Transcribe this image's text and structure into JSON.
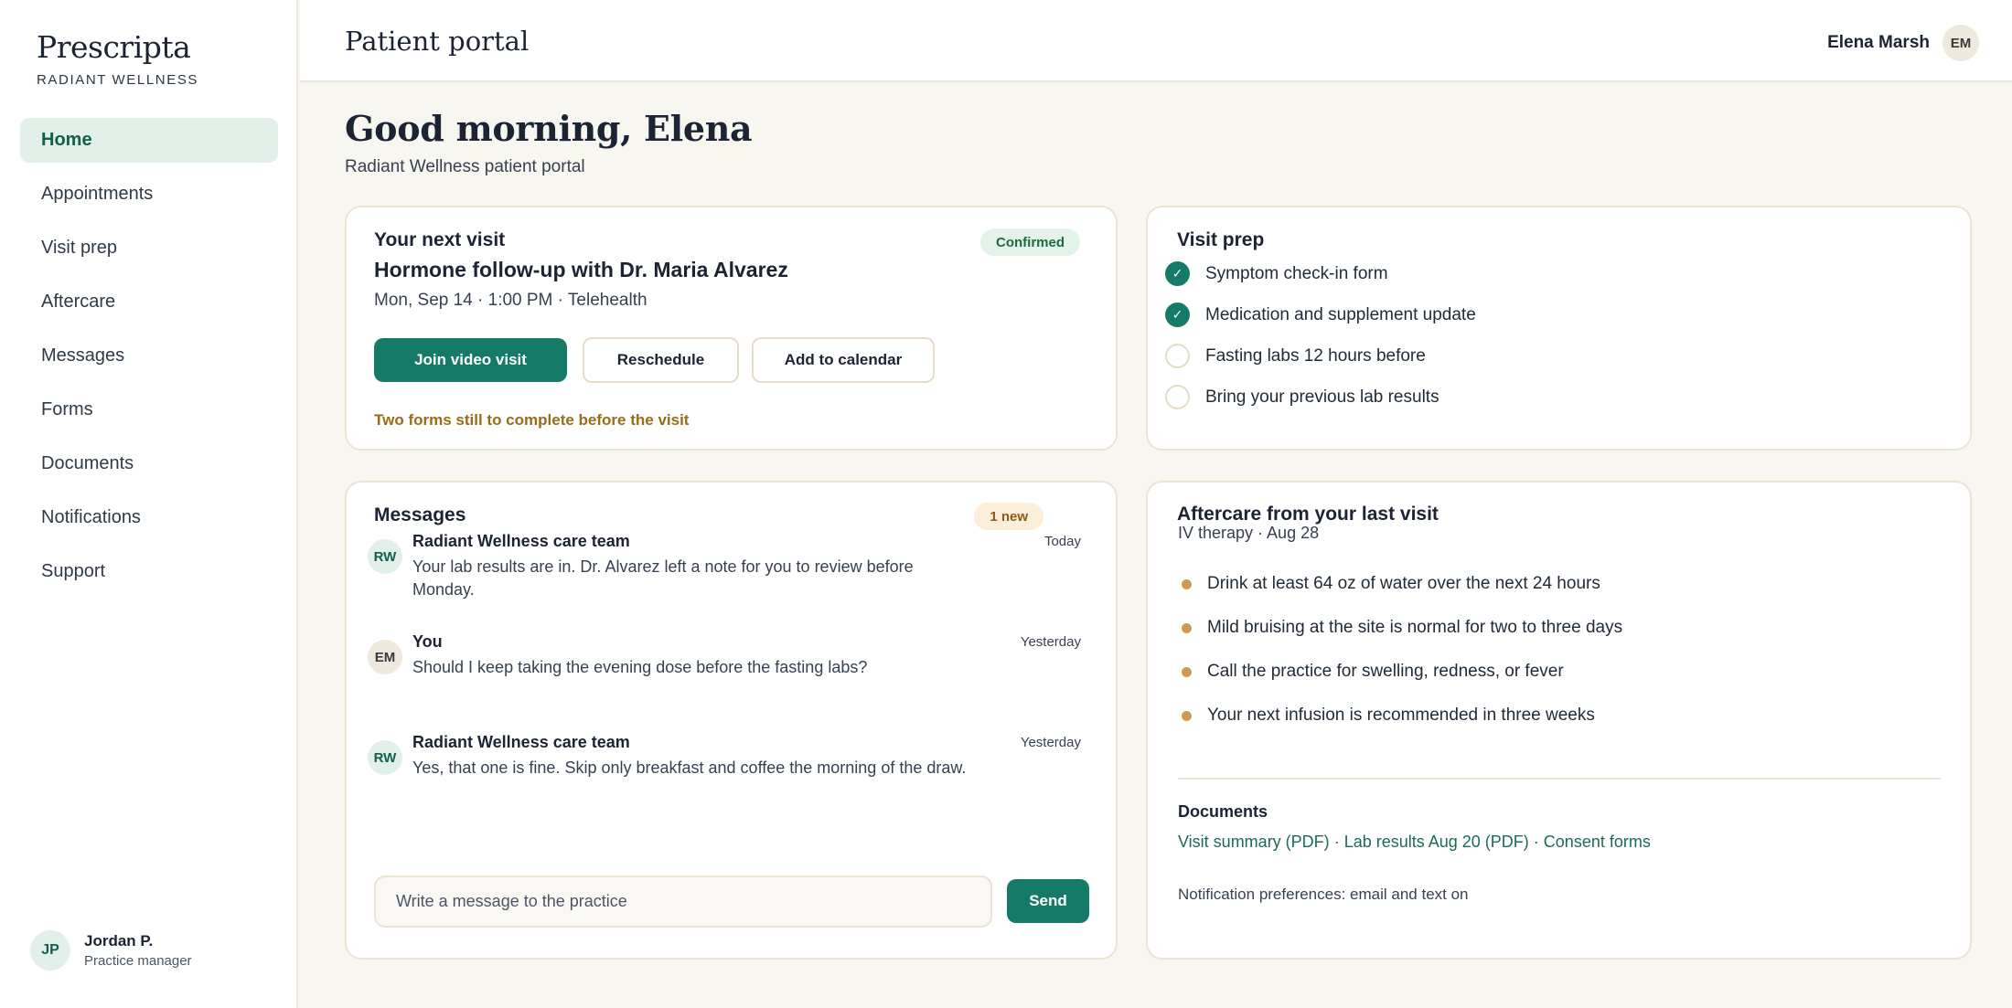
{
  "brand": {
    "name": "Prescripta",
    "subtitle": "RADIANT WELLNESS"
  },
  "nav": [
    {
      "label": "Home",
      "active": true
    },
    {
      "label": "Appointments"
    },
    {
      "label": "Visit prep"
    },
    {
      "label": "Aftercare"
    },
    {
      "label": "Messages"
    },
    {
      "label": "Forms"
    },
    {
      "label": "Documents"
    },
    {
      "label": "Notifications"
    },
    {
      "label": "Support"
    }
  ],
  "sidebar_user": {
    "initials": "JP",
    "name": "Jordan P.",
    "role": "Practice manager"
  },
  "topbar": {
    "title": "Patient portal",
    "user_name": "Elena Marsh",
    "user_initials": "EM"
  },
  "greeting": {
    "title": "Good morning, Elena",
    "subtitle": "Radiant Wellness patient portal"
  },
  "next_visit": {
    "heading": "Your next visit",
    "status": "Confirmed",
    "title": "Hormone follow-up with Dr. Maria Alvarez",
    "when": "Mon, Sep 14 · 1:00 PM · Telehealth",
    "join_label": "Join video visit",
    "reschedule_label": "Reschedule",
    "calendar_label": "Add to calendar",
    "warning": "Two forms still to complete before the visit"
  },
  "visit_prep": {
    "heading": "Visit prep",
    "items": [
      {
        "label": "Symptom check-in form",
        "done": true
      },
      {
        "label": "Medication and supplement update",
        "done": true
      },
      {
        "label": "Fasting labs 12 hours before",
        "done": false
      },
      {
        "label": "Bring your previous lab results",
        "done": false
      }
    ],
    "check_glyph": "✓"
  },
  "messages": {
    "heading": "Messages",
    "badge": "1 new",
    "items": [
      {
        "initials": "RW",
        "sender": "Radiant Wellness care team",
        "time": "Today",
        "body": "Your lab results are in. Dr. Alvarez left a note for you to review before Monday."
      },
      {
        "initials": "EM",
        "sender": "You",
        "time": "Yesterday",
        "body": "Should I keep taking the evening dose before the fasting labs?"
      },
      {
        "initials": "RW",
        "sender": "Radiant Wellness care team",
        "time": "Yesterday",
        "body": "Yes, that one is fine. Skip only breakfast and coffee the morning of the draw."
      }
    ],
    "input_placeholder": "Write a message to the practice",
    "send_label": "Send"
  },
  "aftercare": {
    "heading": "Aftercare from your last visit",
    "subtitle": "IV therapy · Aug 28",
    "items": [
      "Drink at least 64 oz of water over the next 24 hours",
      "Mild bruising at the site is normal for two to three days",
      "Call the practice for swelling, redness, or fever",
      "Your next infusion is recommended in three weeks"
    ],
    "documents_label": "Documents",
    "documents": [
      "Visit summary (PDF)",
      "Lab results Aug 20 (PDF)",
      "Consent forms"
    ],
    "doc_separator": " · ",
    "notification_pref": "Notification preferences: email and text on"
  },
  "colors": {
    "accent": "#157a68",
    "bullet": "#c99a52",
    "warning": "#9a6b1a"
  }
}
